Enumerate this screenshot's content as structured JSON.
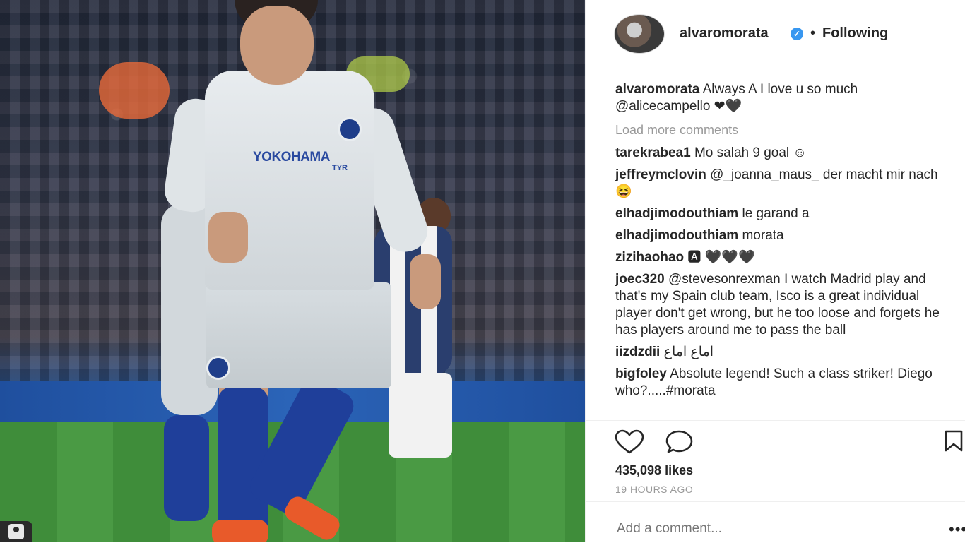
{
  "post": {
    "photo_sponsor": "YOKOHAMA",
    "photo_sponsor_sub": "TYR"
  },
  "header": {
    "username": "alvaromorata",
    "separator": "•",
    "follow_status": "Following"
  },
  "caption": {
    "username": "alvaromorata",
    "text": "Always A I love u so much @alicecampello ❤🖤"
  },
  "load_more": "Load more comments",
  "comments": [
    {
      "username": "tarekrabea1",
      "text": "Mo salah 9 goal ☺"
    },
    {
      "username": "jeffreymclovin",
      "text": "@_joanna_maus_ der macht mir nach 😆"
    },
    {
      "username": "elhadjimodouthiam",
      "text": "le garand a"
    },
    {
      "username": "elhadjimodouthiam",
      "text": "morata"
    },
    {
      "username": "zizihaohao",
      "text": "🅰 🖤🖤🖤"
    },
    {
      "username": "joec320",
      "text": "@stevesonrexman I watch Madrid play and that's my Spain club team, Isco is a great individual player don't get wrong, but he too loose and forgets he has players around me to pass the ball"
    },
    {
      "username": "iizdzdii",
      "text": "اماع اماع"
    },
    {
      "username": "bigfoley",
      "text": "Absolute legend! Such a class striker! Diego who?.....#morata"
    }
  ],
  "icons": {
    "like": "heart-icon",
    "comment": "comment-icon",
    "save": "bookmark-icon",
    "verified": "verified-badge-icon"
  },
  "likes": "435,098 likes",
  "timestamp": "19 HOURS AGO",
  "add_comment_placeholder": "Add a comment...",
  "more_options": "•••",
  "colors": {
    "verified": "#3897f0",
    "muted": "#999999",
    "text": "#262626"
  }
}
